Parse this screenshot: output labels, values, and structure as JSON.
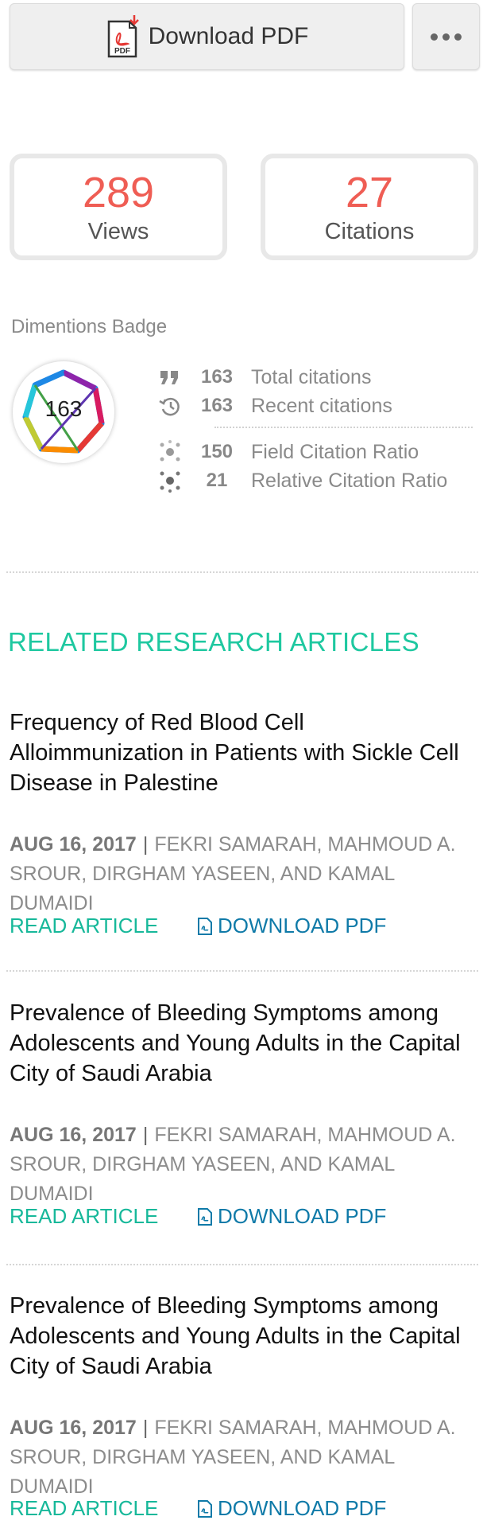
{
  "header": {
    "download_label": "Download PDF",
    "pdf_icon_text": "PDF"
  },
  "metrics": {
    "views_value": "289",
    "views_label": "Views",
    "citations_value": "27",
    "citations_label": "Citations"
  },
  "dimensions": {
    "title": "Dimentions Badge",
    "badge_value": "163",
    "stats": [
      {
        "value": "163",
        "label": "Total citations",
        "icon": "quote-icon"
      },
      {
        "value": "163",
        "label": "Recent citations",
        "icon": "history-icon"
      },
      {
        "value": "150",
        "label": "Field Citation Ratio",
        "icon": "network-icon"
      },
      {
        "value": "21",
        "label": "Relative Citation Ratio",
        "icon": "network-icon"
      }
    ]
  },
  "related": {
    "title": "RELATED RESEARCH ARTICLES",
    "articles": [
      {
        "title": "Frequency of Red Blood Cell Alloimmunization in Patients with Sickle Cell Disease in Palestine",
        "date": "AUG 16, 2017",
        "separator": "|",
        "authors": "FEKRI SAMARAH, MAHMOUD A. SROUR, DIRGHAM YASEEN, AND KAMAL DUMAIDI",
        "read_label": "READ ARTICLE",
        "pdf_label": "DOWNLOAD PDF"
      },
      {
        "title": "Prevalence of Bleeding Symptoms among Adolescents and Young Adults in the Capital City of Saudi Arabia",
        "date": "AUG 16, 2017",
        "separator": "|",
        "authors": "FEKRI SAMARAH, MAHMOUD A. SROUR, DIRGHAM YASEEN, AND KAMAL DUMAIDI",
        "read_label": "READ ARTICLE",
        "pdf_label": "DOWNLOAD PDF"
      },
      {
        "title": "Prevalence of Bleeding Symptoms among Adolescents and Young Adults in the Capital City of Saudi Arabia",
        "date": "AUG 16, 2017",
        "separator": "|",
        "authors": "FEKRI SAMARAH, MAHMOUD A. SROUR, DIRGHAM YASEEN, AND KAMAL DUMAIDI",
        "read_label": "READ ARTICLE",
        "pdf_label": "DOWNLOAD PDF"
      }
    ]
  },
  "colors": {
    "accent_red": "#ef5d54",
    "accent_green": "#1ec8a0",
    "link_blue": "#0f7aa8"
  }
}
